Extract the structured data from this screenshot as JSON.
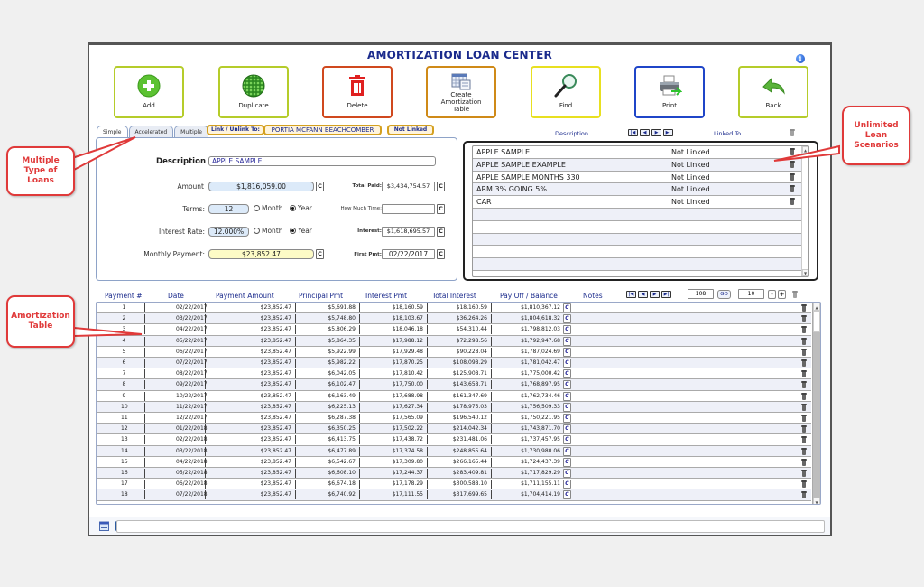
{
  "window": {
    "title": "AMORTIZATION LOAN CENTER",
    "info_icon": "info-icon"
  },
  "toolbar": [
    {
      "label": "Add",
      "icon": "add-icon",
      "color": "#b5cc2a"
    },
    {
      "label": "Duplicate",
      "icon": "duplicate-icon",
      "color": "#b5cc2a"
    },
    {
      "label": "Delete",
      "icon": "trash-icon",
      "color": "#d0481e"
    },
    {
      "label": "Create Amortization Table",
      "icon": "calendar-table-icon",
      "color": "#cf8a18"
    },
    {
      "label": "Find",
      "icon": "magnifier-icon",
      "color": "#e8e020"
    },
    {
      "label": "Print",
      "icon": "printer-icon",
      "color": "#1f45c8"
    },
    {
      "label": "Back",
      "icon": "back-arrow-icon",
      "color": "#b5cc2a"
    }
  ],
  "tabs": [
    {
      "label": "Simple",
      "active": true
    },
    {
      "label": "Accelerated",
      "active": false
    },
    {
      "label": "Multiple",
      "active": false
    }
  ],
  "link": {
    "link_button": "Link / Unlink To:",
    "linked_name": "PORTIA MCFANN BEACHCOMBER",
    "status": "Not Linked"
  },
  "form": {
    "description_label": "Description",
    "description_value": "APPLE SAMPLE",
    "amount_label": "Amount",
    "amount_value": "$1,816,059.00",
    "terms_label": "Terms:",
    "terms_value": "12",
    "terms_unit_options": [
      "Month",
      "Year"
    ],
    "terms_unit_selected": "Year",
    "rate_label": "Interest Rate:",
    "rate_value": "12.000%",
    "rate_unit_options": [
      "Month",
      "Year"
    ],
    "rate_unit_selected": "Year",
    "payment_label": "Monthly Payment:",
    "payment_value": "$23,852.47",
    "total_paid_label": "Total Paid:",
    "total_paid_value": "$3,434,754.57",
    "how_much_time_label": "How Much Time:",
    "how_much_time_value": "",
    "interest_label": "Interest:",
    "interest_value": "$1,618,695.57",
    "first_pmt_label": "First Pmt:",
    "first_pmt_value": "02/22/2017",
    "calc_button": "C"
  },
  "scenarios": {
    "header_description": "Description",
    "header_linked": "Linked To",
    "nav_buttons": [
      "first",
      "prev",
      "next",
      "last"
    ],
    "rows": [
      {
        "description": "APPLE SAMPLE",
        "linked": "Not Linked"
      },
      {
        "description": "APPLE SAMPLE EXAMPLE",
        "linked": "Not Linked"
      },
      {
        "description": "APPLE SAMPLE MONTHS 330",
        "linked": "Not Linked"
      },
      {
        "description": "ARM 3% GOING 5%",
        "linked": "Not Linked"
      },
      {
        "description": "CAR",
        "linked": "Not Linked"
      }
    ],
    "empty_rows": 5
  },
  "amortization": {
    "columns": [
      "Payment #",
      "Date",
      "Payment Amount",
      "Principal Pmt",
      "Interest Pmt",
      "Total Interest",
      "Pay Off / Balance",
      "Notes"
    ],
    "paging": {
      "page_value": "108",
      "go_label": "GO",
      "rows_value": "10",
      "minus": "-",
      "plus": "+"
    },
    "rows": [
      [
        "1",
        "02/22/2017",
        "$23,852.47",
        "$5,691.88",
        "$18,160.59",
        "$18,160.59",
        "$1,810,367.12"
      ],
      [
        "2",
        "03/22/2017",
        "$23,852.47",
        "$5,748.80",
        "$18,103.67",
        "$36,264.26",
        "$1,804,618.32"
      ],
      [
        "3",
        "04/22/2017",
        "$23,852.47",
        "$5,806.29",
        "$18,046.18",
        "$54,310.44",
        "$1,798,812.03"
      ],
      [
        "4",
        "05/22/2017",
        "$23,852.47",
        "$5,864.35",
        "$17,988.12",
        "$72,298.56",
        "$1,792,947.68"
      ],
      [
        "5",
        "06/22/2017",
        "$23,852.47",
        "$5,922.99",
        "$17,929.48",
        "$90,228.04",
        "$1,787,024.69"
      ],
      [
        "6",
        "07/22/2017",
        "$23,852.47",
        "$5,982.22",
        "$17,870.25",
        "$108,098.29",
        "$1,781,042.47"
      ],
      [
        "7",
        "08/22/2017",
        "$23,852.47",
        "$6,042.05",
        "$17,810.42",
        "$125,908.71",
        "$1,775,000.42"
      ],
      [
        "8",
        "09/22/2017",
        "$23,852.47",
        "$6,102.47",
        "$17,750.00",
        "$143,658.71",
        "$1,768,897.95"
      ],
      [
        "9",
        "10/22/2017",
        "$23,852.47",
        "$6,163.49",
        "$17,688.98",
        "$161,347.69",
        "$1,762,734.46"
      ],
      [
        "10",
        "11/22/2017",
        "$23,852.47",
        "$6,225.13",
        "$17,627.34",
        "$178,975.03",
        "$1,756,509.33"
      ],
      [
        "11",
        "12/22/2017",
        "$23,852.47",
        "$6,287.38",
        "$17,565.09",
        "$196,540.12",
        "$1,750,221.95"
      ],
      [
        "12",
        "01/22/2018",
        "$23,852.47",
        "$6,350.25",
        "$17,502.22",
        "$214,042.34",
        "$1,743,871.70"
      ],
      [
        "13",
        "02/22/2018",
        "$23,852.47",
        "$6,413.75",
        "$17,438.72",
        "$231,481.06",
        "$1,737,457.95"
      ],
      [
        "14",
        "03/22/2018",
        "$23,852.47",
        "$6,477.89",
        "$17,374.58",
        "$248,855.64",
        "$1,730,980.06"
      ],
      [
        "15",
        "04/22/2018",
        "$23,852.47",
        "$6,542.67",
        "$17,309.80",
        "$266,165.44",
        "$1,724,437.39"
      ],
      [
        "16",
        "05/22/2018",
        "$23,852.47",
        "$6,608.10",
        "$17,244.37",
        "$283,409.81",
        "$1,717,829.29"
      ],
      [
        "17",
        "06/22/2018",
        "$23,852.47",
        "$6,674.18",
        "$17,178.29",
        "$300,588.10",
        "$1,711,155.11"
      ],
      [
        "18",
        "07/22/2018",
        "$23,852.47",
        "$6,740.92",
        "$17,111.55",
        "$317,699.65",
        "$1,704,414.19"
      ]
    ]
  },
  "footer": {
    "icons": [
      "calendar-icon",
      "calculator-icon"
    ]
  },
  "callouts": [
    {
      "text": "Multiple Type of Loans"
    },
    {
      "text": "Unlimited Loan Scenarios"
    },
    {
      "text": "Amortization Table"
    }
  ],
  "colors": {
    "title": "#1a2a8c",
    "callout": "#e03a3a",
    "pill_border": "#d4a020",
    "payment_bg": "#fdfbc6",
    "input_bg": "#dceaf9"
  }
}
